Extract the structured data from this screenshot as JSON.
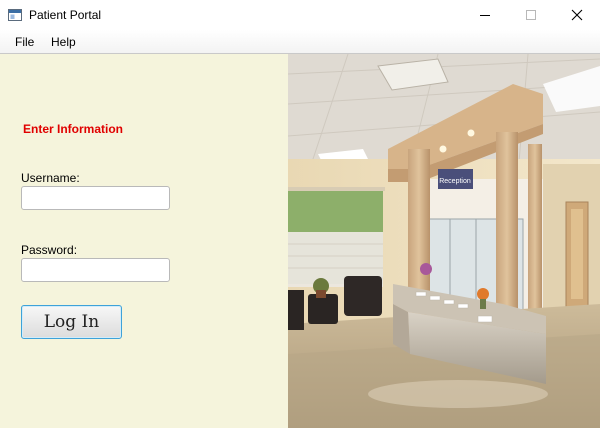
{
  "window": {
    "title": "Patient Portal"
  },
  "menu": [
    "File",
    "Help"
  ],
  "form": {
    "section_title": "Enter Information",
    "username_label": "Username:",
    "username_value": "",
    "password_label": "Password:",
    "password_value": "",
    "login_label": "Log In"
  },
  "photo": {
    "sign_text": "Reception"
  },
  "colors": {
    "panel_bg": "#f5f4dc",
    "section_title": "#e00000",
    "button_focus_border": "#3ea2d9"
  },
  "icons": [
    "app-window-icon",
    "minimize-icon",
    "maximize-icon",
    "close-icon"
  ]
}
